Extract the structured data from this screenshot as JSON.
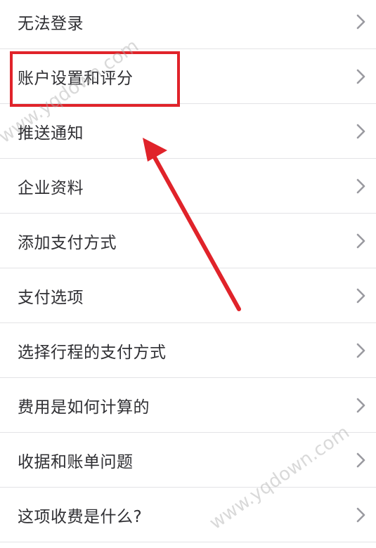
{
  "menu": {
    "items": [
      {
        "label": "无法登录"
      },
      {
        "label": "账户设置和评分"
      },
      {
        "label": "推送通知"
      },
      {
        "label": "企业资料"
      },
      {
        "label": "添加支付方式"
      },
      {
        "label": "支付选项"
      },
      {
        "label": "选择行程的支付方式"
      },
      {
        "label": "费用是如何计算的"
      },
      {
        "label": "收据和账单问题"
      },
      {
        "label": "这项收费是什么?"
      }
    ],
    "chevron_icon": "chevron-right-icon",
    "chevron_color": "#9a9aa0",
    "divider_color": "#e3e3e6"
  },
  "annotation": {
    "highlight_color": "#e0232a",
    "highlighted_item": "账户设置和评分",
    "arrow_color": "#e0232a"
  },
  "watermark": {
    "text": "www.yqdown.com"
  }
}
